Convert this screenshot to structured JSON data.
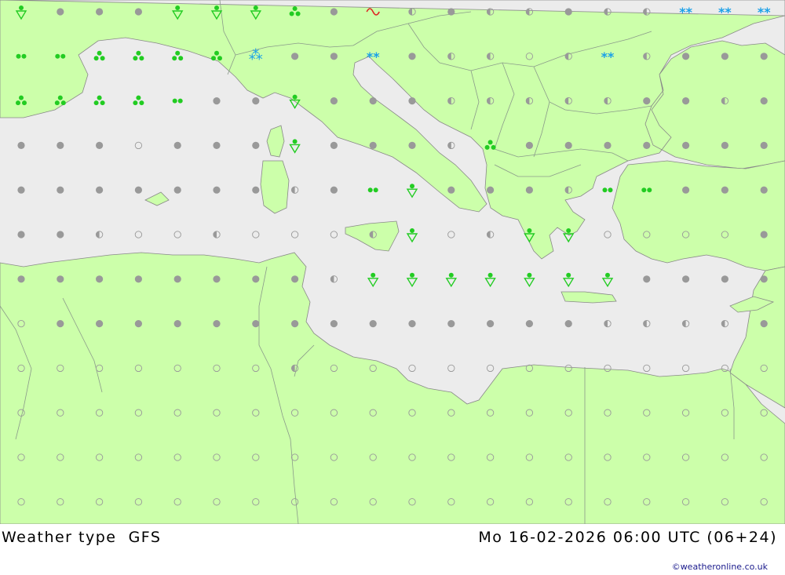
{
  "footer": {
    "title": "Weather type",
    "model": "GFS",
    "datetime": "Mo 16-02-2026 06:00 UTC (06+24)",
    "credit": "©weatheronline.co.uk"
  },
  "colors": {
    "land": "#ccffaa",
    "sea": "#ececec",
    "border": "#8a9a8a",
    "coast": "#888888",
    "rain_symbol": "#22cc22",
    "snow_symbol": "#1aa0e8",
    "cloud_symbol": "#999999",
    "thunder_symbol": "#dd2222"
  },
  "legend_symbols": {
    "o": "clear",
    "h": "partly-cloudy",
    "c": "overcast",
    "d": "drizzle",
    "r": "rain",
    "t": "rain-showers",
    "s": "shower",
    "w": "snow",
    "m": "snow-showers",
    "f": "fog"
  },
  "grid": {
    "rows": [
      "scccsssrcfhchhchhwww",
      "ddrrrrmccwchhohwhccc",
      "rrrrdccsccchhhhhcchc",
      "cccocccsccchrccccccc",
      "ccccccchcdsccchddccc",
      "cchoohooohsohssooooc",
      "cccccccchssssssscccc",
      "occcccccccccccchhhhc",
      "ooooooohoooooooooooo",
      "oooooooooooooooooooo",
      "oooooooooooooooooooo",
      "oooooooooooooooooooo"
    ]
  }
}
